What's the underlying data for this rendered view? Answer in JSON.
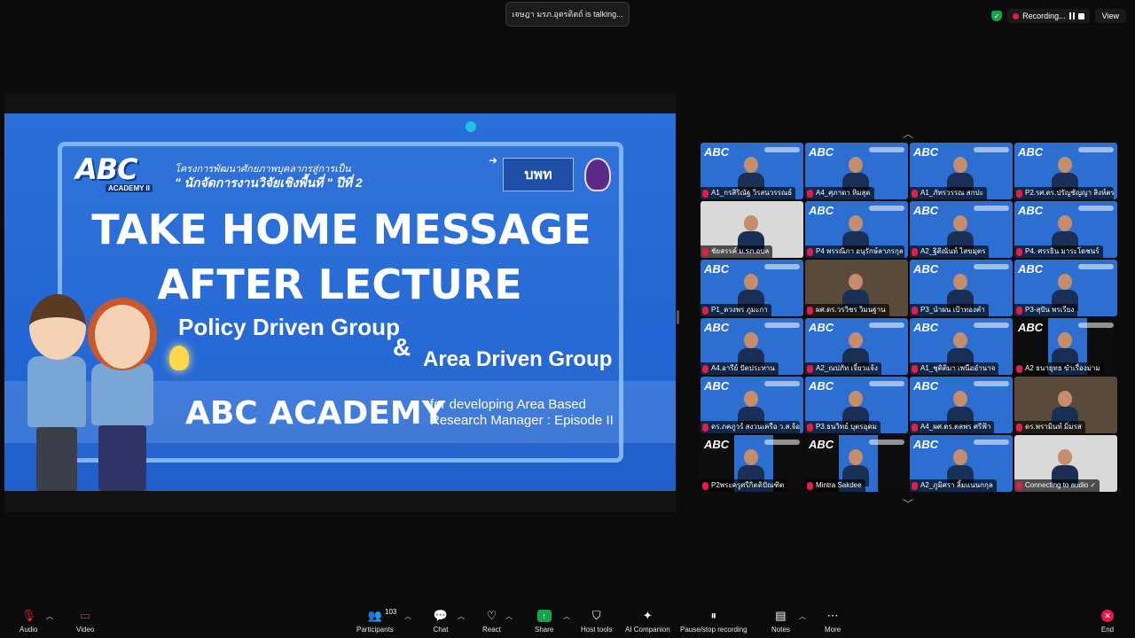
{
  "top": {
    "talking": "เจษฎา มรภ.อุตรดิตถ์ is talking...",
    "recording_label": "Recording...",
    "view_label": "View"
  },
  "slide": {
    "project_line1": "โครงการพัฒนาศักยภาพบุคลากรสู่การเป็น",
    "project_line2": "\" นักจัดการงานวิจัยเชิงพื้นที่ \" ปีที่ 2",
    "logo_abc": "ABC",
    "logo_abc_sub": "ACADEMY II",
    "logo_pwk": "บพท",
    "heading_line1": "TAKE HOME MESSAGE",
    "heading_line2": "AFTER LECTURE",
    "group1": "Policy Driven Group",
    "amp": "&",
    "group2": "Area Driven Group",
    "band_title": "ABC ACADEMY",
    "band_sub1": "for developing Area Based",
    "band_sub2": "Research Manager : Episode II"
  },
  "gallery": {
    "tiles": [
      {
        "name": "A1_กรสิริณัฐ วิรสนวรรณธ์",
        "style": "slide"
      },
      {
        "name": "A4_ศุภาดา หิมสุด",
        "style": "slide"
      },
      {
        "name": "A1_ภัทรวรรณ สกปะ",
        "style": "slide"
      },
      {
        "name": "P2.รศ.ดร.ปรัญชัญญา สิงห์ตระ",
        "style": "slide"
      },
      {
        "name": "ชัยสรรค์ ม.รภ.อบล",
        "style": "room"
      },
      {
        "name": "P4 พรรณิภา อนุรักษ์ลาภรกุล",
        "style": "slide"
      },
      {
        "name": "A2_ฐิติณันท์ ไสขมุตร",
        "style": "slide"
      },
      {
        "name": "P4. ศรรธิน มาระโดชนร์",
        "style": "slide"
      },
      {
        "name": "P1_ดวงพร ภูมะกา",
        "style": "slide"
      },
      {
        "name": "ผศ.ดร.วรวิชร วิมนฐาน",
        "style": "photo"
      },
      {
        "name": "P3_นำผน เป้าทองคำ",
        "style": "slide"
      },
      {
        "name": "P3-สุปัน พรเรียง",
        "style": "slide"
      },
      {
        "name": "A4.อารีย์ ปัตประทาน",
        "style": "slide"
      },
      {
        "name": "A2_ณปภัท เจี๋ยวแจ้ง",
        "style": "slide"
      },
      {
        "name": "A1_ชุติติมา เพนืออำนาจ",
        "style": "slide"
      },
      {
        "name": "A2 ธนายุทธ ขำเรื่องม่าม",
        "style": "black"
      },
      {
        "name": "ดร.ภคภูวร์ สงวนเครือ ว.ส.จ้อ...",
        "style": "slide"
      },
      {
        "name": "P3.ธนวิทย์ บุตรอุดม",
        "style": "slide"
      },
      {
        "name": "A4_ผศ.ดร.ตลพร ศรีฟ้า",
        "style": "slide"
      },
      {
        "name": "ดร.พรามินท์ มิ่มรส",
        "style": "photo"
      },
      {
        "name": "P2พระครูศรีกิตติปัณฑิต",
        "style": "black"
      },
      {
        "name": "Mintra Sakdee",
        "style": "black"
      },
      {
        "name": "A2_ภูมิศรา ลิ้มแนนกกุล",
        "style": "slide"
      },
      {
        "name": "Connecting to audio ✓",
        "style": "room"
      }
    ]
  },
  "toolbar": {
    "audio": "Audio",
    "video": "Video",
    "participants": "Participants",
    "participants_count": "103",
    "chat": "Chat",
    "react": "React",
    "share": "Share",
    "host_tools": "Host tools",
    "ai_companion": "AI Companion",
    "pause_recording": "Pause/stop recording",
    "notes": "Notes",
    "more": "More",
    "end": "End"
  },
  "colors": {
    "slide_blue": "#2166d4",
    "recording_red": "#e11d48",
    "share_green": "#16a34a"
  }
}
